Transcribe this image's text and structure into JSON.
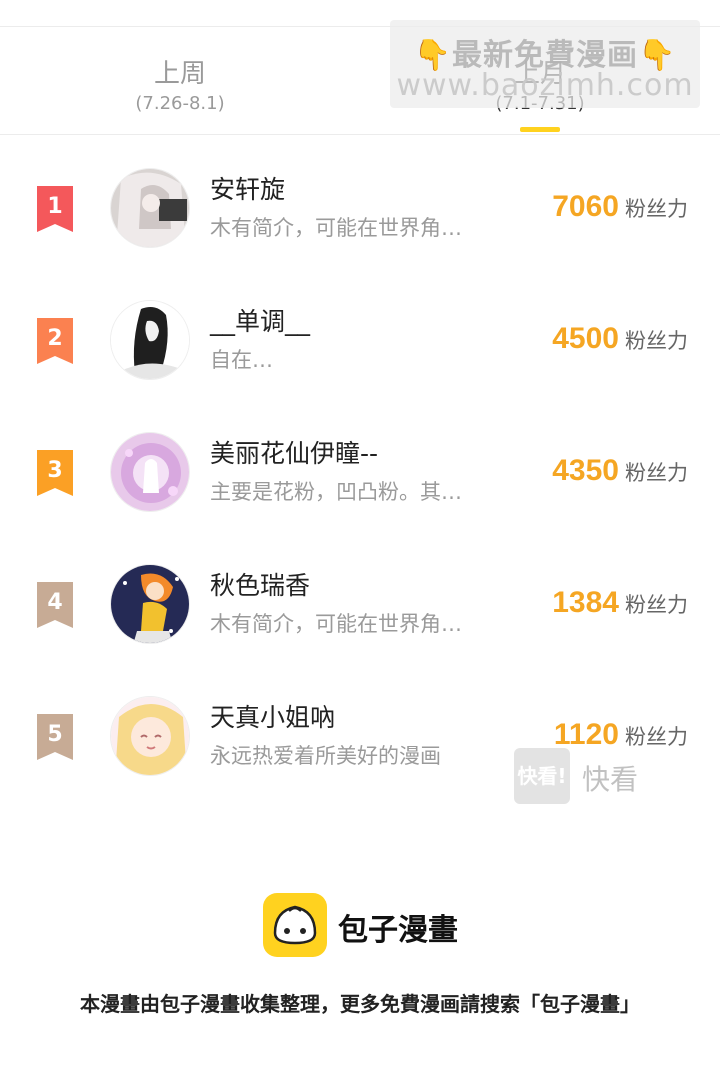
{
  "tabs": [
    {
      "label": "上周",
      "range": "(7.26-8.1)"
    },
    {
      "label": "上月",
      "range": "(7.1-7.31)"
    }
  ],
  "watermark_top": {
    "line1": "最新免費漫画",
    "line2": "www.baozimh.com",
    "hand": "👇"
  },
  "ranking": [
    {
      "rank": "1",
      "name": "安轩旋",
      "bio": "木有简介，可能在世界角…",
      "score": "7060",
      "unit": "粉丝力",
      "badge_color": "#f4585b"
    },
    {
      "rank": "2",
      "name": "__单调__",
      "bio": "自在…",
      "score": "4500",
      "unit": "粉丝力",
      "badge_color": "#fb8150"
    },
    {
      "rank": "3",
      "name": "美丽花仙伊瞳--",
      "bio": "主要是花粉，凹凸粉。其…",
      "score": "4350",
      "unit": "粉丝力",
      "badge_color": "#fba025"
    },
    {
      "rank": "4",
      "name": "秋色瑞香",
      "bio": "木有简介，可能在世界角…",
      "score": "1384",
      "unit": "粉丝力",
      "badge_color": "#c7ab95"
    },
    {
      "rank": "5",
      "name": "天真小姐吶",
      "bio": "永远热爱着所美好的漫画",
      "score": "1120",
      "unit": "粉丝力",
      "badge_color": "#c7ab95"
    }
  ],
  "watermark_kk": {
    "box": "快看!",
    "text": "快看"
  },
  "footer": {
    "brand": "包子漫畫",
    "note": "本漫畫由包子漫畫收集整理，更多免費漫画請搜索「包子漫畫」"
  }
}
